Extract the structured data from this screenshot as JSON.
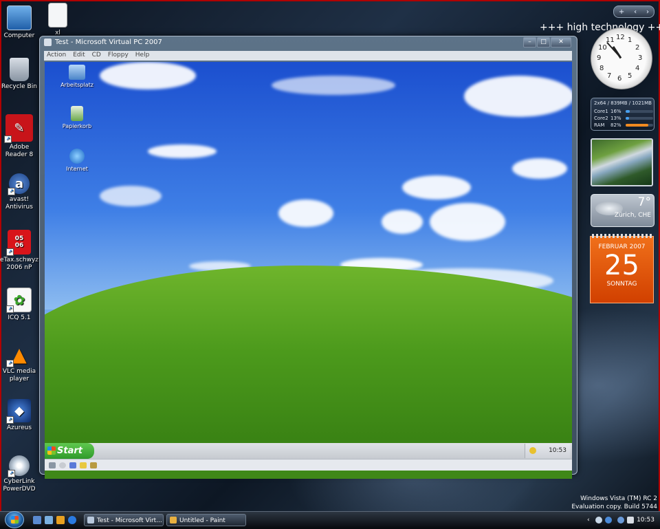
{
  "desktop": {
    "brand_text": "+++ high technology +++",
    "top_bar_glyphs": [
      "+",
      "‹",
      "›"
    ],
    "icons": [
      {
        "label": "Computer"
      },
      {
        "label": "Recycle Bin"
      },
      {
        "label": "Adobe Reader 8"
      },
      {
        "label": "avast! Antivirus"
      },
      {
        "label": "eTax.schwyz 2006 nP",
        "badge": "05",
        "badge2": "06"
      },
      {
        "label": "ICQ 5.1"
      },
      {
        "label": "VLC media player"
      },
      {
        "label": "Azureus"
      },
      {
        "label": "CyberLink PowerDVD"
      }
    ],
    "top_icon_label": "xl"
  },
  "vpc_window": {
    "title": "Test - Microsoft Virtual PC 2007",
    "menu": [
      "Action",
      "Edit",
      "CD",
      "Floppy",
      "Help"
    ],
    "buttons": [
      "–",
      "□",
      "✕"
    ],
    "guest": {
      "icons": [
        {
          "label": "Arbeitsplatz"
        },
        {
          "label": "Papierkorb"
        },
        {
          "label": "Internet"
        }
      ],
      "start_label": "Start",
      "clock": "10:53"
    }
  },
  "gadgets": {
    "cpu": {
      "header": "2x64 / 839MB / 1021MB",
      "rows": [
        {
          "name": "Core1",
          "value": "16%",
          "fill": 0.16
        },
        {
          "name": "Core2",
          "value": "13%",
          "fill": 0.13
        },
        {
          "name": "RAM",
          "value": "82%",
          "fill": 0.82
        }
      ]
    },
    "weather": {
      "temp": "7°",
      "city": "Zürich, CHE"
    },
    "calendar": {
      "month": "FEBRUAR 2007",
      "day": "25",
      "weekday": "SONNTAG"
    },
    "clock_numbers": [
      "12",
      "1",
      "2",
      "3",
      "4",
      "5",
      "6",
      "7",
      "8",
      "9",
      "10",
      "11"
    ]
  },
  "watermark": {
    "line1": "Windows Vista (TM) RC 2",
    "line2": "Evaluation copy. Build 5744"
  },
  "taskbar": {
    "buttons": [
      {
        "label": "Test - Microsoft Virt..."
      },
      {
        "label": "Untitled - Paint"
      }
    ],
    "clock": "10:53",
    "colors": {
      "accent": "#f0701a",
      "taskbar": "#07090d"
    }
  }
}
